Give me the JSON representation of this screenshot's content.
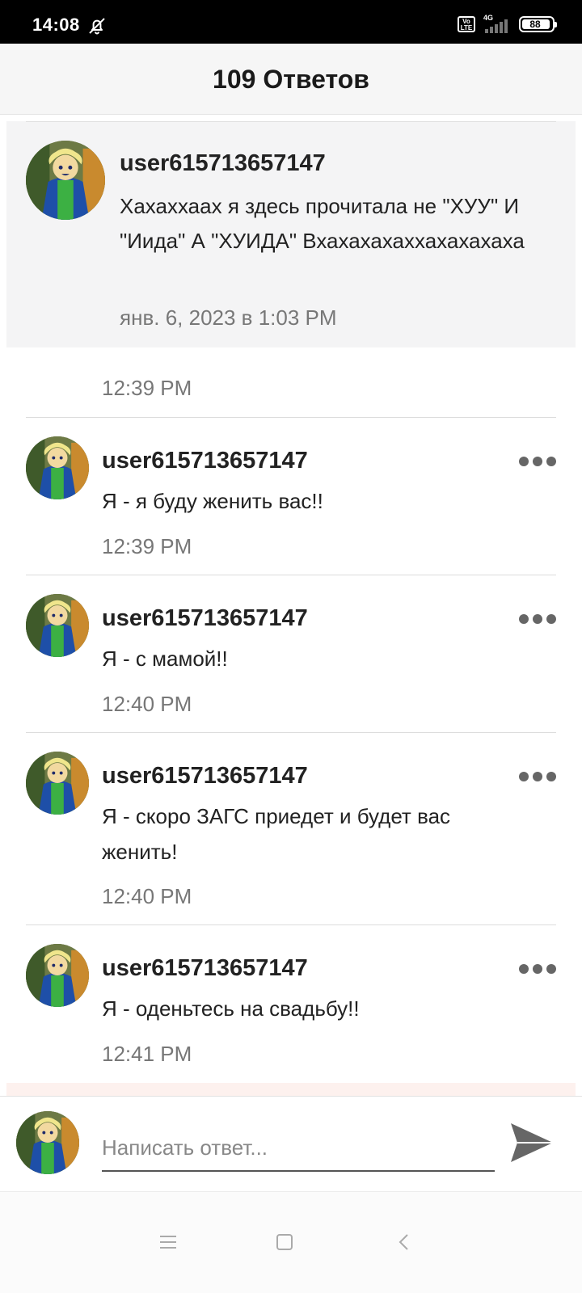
{
  "status_bar": {
    "time": "14:08",
    "network": "4G",
    "volte": "Vo LTE",
    "battery": "88"
  },
  "header": {
    "title": "109 Ответов"
  },
  "parent_comment": {
    "username": "user615713657147",
    "text": "Хахаххаах я здесь прочитала не \"ХУУ\" И \"Иида\" А \"ХУИДА\" Вхахахахаххахахахаха",
    "date": "янв. 6, 2023 в 1:03 PM"
  },
  "first_time": "12:39 PM",
  "replies": [
    {
      "username": "user615713657147",
      "text": "Я - я буду женить вас!!",
      "time": "12:39 PM"
    },
    {
      "username": "user615713657147",
      "text": "Я - с мамой!!",
      "time": "12:40 PM"
    },
    {
      "username": "user615713657147",
      "text": "Я - скоро ЗАГС приедет и будет вас женить!",
      "time": "12:40 PM"
    },
    {
      "username": "user615713657147",
      "text": "Я - оденьтесь на свадьбу!!",
      "time": "12:41 PM"
    }
  ],
  "composer": {
    "placeholder": "Написать ответ..."
  },
  "colors": {
    "header_bg": "#f6f6f6",
    "parent_bg": "#f4f4f5",
    "muted_text": "#777777",
    "send_icon": "#666666"
  },
  "icons": {
    "notifications_off": "bell-off-icon",
    "more": "more-dots-icon",
    "send": "send-icon",
    "nav_menu": "menu-icon",
    "nav_home": "square-icon",
    "nav_back": "back-chevron-icon"
  }
}
